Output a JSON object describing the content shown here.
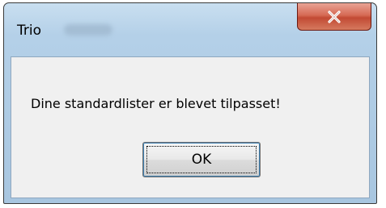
{
  "window": {
    "title": "Trio"
  },
  "titlebar": {
    "close_icon": "close-x-icon"
  },
  "dialog": {
    "message": "Dine standardlister er blevet tilpasset!",
    "ok_label": "OK"
  },
  "colors": {
    "frame": "#b4d0e8",
    "close_button": "#c24a34",
    "client_background": "#f0f0f0"
  }
}
